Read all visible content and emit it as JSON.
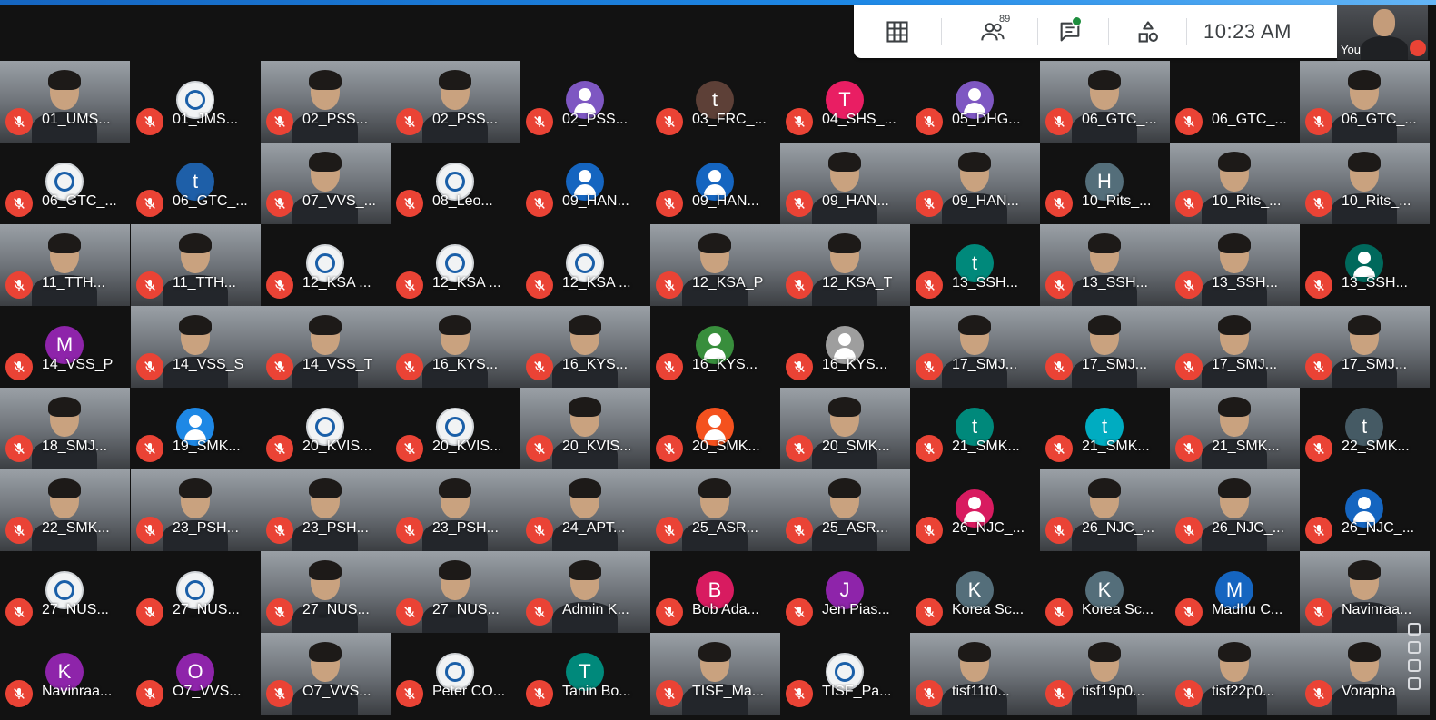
{
  "toolbar": {
    "participants_count": "89",
    "time": "10:23  AM",
    "self_label": "You"
  },
  "colors": {
    "mic_off": "#ea4335",
    "brand_bar": "#1e88e5"
  },
  "icons": [
    "grid-layout-icon",
    "participants-icon",
    "chat-icon",
    "activities-icon",
    "mic-off-icon"
  ],
  "participants": [
    {
      "name": "01_UMS...",
      "type": "video"
    },
    {
      "name": "01_JMS...",
      "type": "logo"
    },
    {
      "name": "02_PSS...",
      "type": "video"
    },
    {
      "name": "02_PSS...",
      "type": "video"
    },
    {
      "name": "02_PSS...",
      "type": "person",
      "color": "#7e57c2"
    },
    {
      "name": "03_FRC_...",
      "type": "letter",
      "letter": "t",
      "color": "#5d4037"
    },
    {
      "name": "04_SHS_...",
      "type": "letter",
      "letter": "T",
      "color": "#e91e63"
    },
    {
      "name": "05_DHG...",
      "type": "person",
      "color": "#7e57c2"
    },
    {
      "name": "06_GTC_...",
      "type": "video"
    },
    {
      "name": "06_GTC_...",
      "type": "blank"
    },
    {
      "name": "06_GTC_...",
      "type": "video"
    },
    {
      "name": "06_GTC_...",
      "type": "logo"
    },
    {
      "name": "06_GTC_...",
      "type": "letter",
      "letter": "t",
      "color": "#1e5fa8"
    },
    {
      "name": "07_VVS_...",
      "type": "video"
    },
    {
      "name": "08_Leo...",
      "type": "logo"
    },
    {
      "name": "09_HAN...",
      "type": "person",
      "color": "#1565c0"
    },
    {
      "name": "09_HAN...",
      "type": "person",
      "color": "#1565c0"
    },
    {
      "name": "09_HAN...",
      "type": "video"
    },
    {
      "name": "09_HAN...",
      "type": "video"
    },
    {
      "name": "10_Rits_...",
      "type": "letter",
      "letter": "H",
      "color": "#546e7a"
    },
    {
      "name": "10_Rits_...",
      "type": "video"
    },
    {
      "name": "10_Rits_...",
      "type": "video"
    },
    {
      "name": "11_TTH...",
      "type": "video"
    },
    {
      "name": "11_TTH...",
      "type": "video"
    },
    {
      "name": "12_KSA ...",
      "type": "logo"
    },
    {
      "name": "12_KSA ...",
      "type": "logo"
    },
    {
      "name": "12_KSA ...",
      "type": "logo"
    },
    {
      "name": "12_KSA_P",
      "type": "video"
    },
    {
      "name": "12_KSA_T",
      "type": "video"
    },
    {
      "name": "13_SSH...",
      "type": "letter",
      "letter": "t",
      "color": "#00897b"
    },
    {
      "name": "13_SSH...",
      "type": "video"
    },
    {
      "name": "13_SSH...",
      "type": "video"
    },
    {
      "name": "13_SSH...",
      "type": "person",
      "color": "#00695c"
    },
    {
      "name": "14_VSS_P",
      "type": "letter",
      "letter": "M",
      "color": "#8e24aa"
    },
    {
      "name": "14_VSS_S",
      "type": "video"
    },
    {
      "name": "14_VSS_T",
      "type": "video"
    },
    {
      "name": "16_KYS...",
      "type": "video"
    },
    {
      "name": "16_KYS...",
      "type": "video"
    },
    {
      "name": "16_KYS...",
      "type": "person",
      "color": "#388e3c"
    },
    {
      "name": "16_KYS...",
      "type": "person",
      "color": "#9e9e9e"
    },
    {
      "name": "17_SMJ...",
      "type": "video"
    },
    {
      "name": "17_SMJ...",
      "type": "video"
    },
    {
      "name": "17_SMJ...",
      "type": "video"
    },
    {
      "name": "17_SMJ...",
      "type": "video"
    },
    {
      "name": "18_SMJ...",
      "type": "video"
    },
    {
      "name": "19_SMK...",
      "type": "person",
      "color": "#1e88e5"
    },
    {
      "name": "20_KVIS...",
      "type": "logo"
    },
    {
      "name": "20_KVIS...",
      "type": "logo"
    },
    {
      "name": "20_KVIS...",
      "type": "video"
    },
    {
      "name": "20_SMK...",
      "type": "person",
      "color": "#f4511e"
    },
    {
      "name": "20_SMK...",
      "type": "video"
    },
    {
      "name": "21_SMK...",
      "type": "letter",
      "letter": "t",
      "color": "#00897b"
    },
    {
      "name": "21_SMK...",
      "type": "letter",
      "letter": "t",
      "color": "#00acc1"
    },
    {
      "name": "21_SMK...",
      "type": "video"
    },
    {
      "name": "22_SMK...",
      "type": "letter",
      "letter": "t",
      "color": "#455a64"
    },
    {
      "name": "22_SMK...",
      "type": "video"
    },
    {
      "name": "23_PSH...",
      "type": "video"
    },
    {
      "name": "23_PSH...",
      "type": "video"
    },
    {
      "name": "23_PSH...",
      "type": "video"
    },
    {
      "name": "24_APT...",
      "type": "video"
    },
    {
      "name": "25_ASR...",
      "type": "video"
    },
    {
      "name": "25_ASR...",
      "type": "video"
    },
    {
      "name": "26_NJC_...",
      "type": "person",
      "color": "#d81b60"
    },
    {
      "name": "26_NJC_...",
      "type": "video"
    },
    {
      "name": "26_NJC_...",
      "type": "video"
    },
    {
      "name": "26_NJC_...",
      "type": "person",
      "color": "#1565c0"
    },
    {
      "name": "27_NUS...",
      "type": "logo"
    },
    {
      "name": "27_NUS...",
      "type": "logo"
    },
    {
      "name": "27_NUS...",
      "type": "video"
    },
    {
      "name": "27_NUS...",
      "type": "video"
    },
    {
      "name": "Admin K...",
      "type": "video"
    },
    {
      "name": "Bob Ada...",
      "type": "letter",
      "letter": "B",
      "color": "#d81b60"
    },
    {
      "name": "Jen Pias...",
      "type": "letter",
      "letter": "J",
      "color": "#8e24aa"
    },
    {
      "name": "Korea Sc...",
      "type": "letter",
      "letter": "K",
      "color": "#546e7a"
    },
    {
      "name": "Korea Sc...",
      "type": "letter",
      "letter": "K",
      "color": "#546e7a"
    },
    {
      "name": "Madhu C...",
      "type": "letter",
      "letter": "M",
      "color": "#1565c0"
    },
    {
      "name": "Navinraa...",
      "type": "video"
    },
    {
      "name": "Navinraa...",
      "type": "letter",
      "letter": "K",
      "color": "#8e24aa"
    },
    {
      "name": "O7_VVS...",
      "type": "letter",
      "letter": "O",
      "color": "#8e24aa"
    },
    {
      "name": "O7_VVS...",
      "type": "video"
    },
    {
      "name": "Peter CO...",
      "type": "logo"
    },
    {
      "name": "Tanin Bo...",
      "type": "letter",
      "letter": "T",
      "color": "#00897b"
    },
    {
      "name": "TISF_Ma...",
      "type": "video"
    },
    {
      "name": "TISF_Pa...",
      "type": "logo"
    },
    {
      "name": "tisf11t0...",
      "type": "video"
    },
    {
      "name": "tisf19p0...",
      "type": "video"
    },
    {
      "name": "tisf22p0...",
      "type": "video"
    },
    {
      "name": "Voraphа",
      "type": "video"
    }
  ]
}
